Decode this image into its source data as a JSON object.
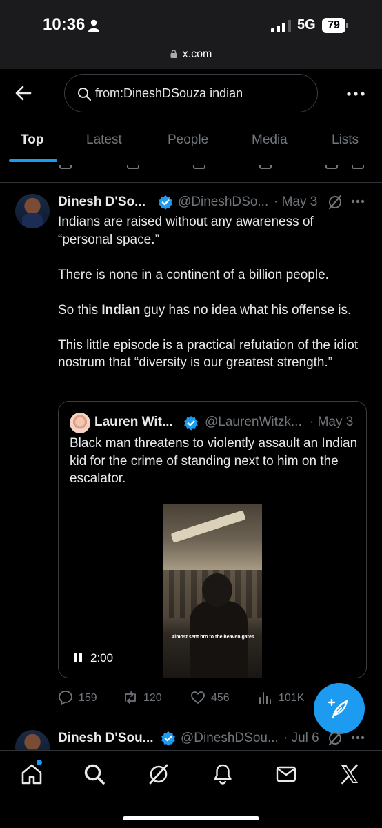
{
  "status_bar": {
    "time": "10:36",
    "network": "5G",
    "battery": "79",
    "url": "x.com"
  },
  "header": {
    "search_value": "from:DineshDSouza indian"
  },
  "tabs": [
    {
      "label": "Top",
      "active": true
    },
    {
      "label": "Latest",
      "active": false
    },
    {
      "label": "People",
      "active": false
    },
    {
      "label": "Media",
      "active": false
    },
    {
      "label": "Lists",
      "active": false
    }
  ],
  "tweet": {
    "author_name": "Dinesh D'So...",
    "author_handle": "@DineshDSo...",
    "date": "· May 3",
    "paragraphs": [
      "Indians are raised without any awareness of “personal space.”",
      "There is none in a continent of a billion people.",
      "This little episode is a practical refutation of the idiot nostrum that  “diversity is our greatest strength.”"
    ],
    "para3_before": "So this ",
    "para3_bold": "Indian",
    "para3_after": " guy has no idea what his offense is.",
    "quote": {
      "author_name": "Lauren Wit...",
      "author_handle": "@LaurenWitzk...",
      "date": "· May 3",
      "text": "Black man threatens to violently assault an Indian kid for the crime of standing next to him on the escalator.",
      "video_caption": "Almost sent bro to the heaven gates",
      "video_time": "2:00"
    },
    "stats": {
      "replies": "159",
      "reposts": "120",
      "likes": "456",
      "views": "101K"
    }
  },
  "next_tweet": {
    "author_name": "Dinesh D'Sou...",
    "author_handle": "@DineshDSou...",
    "date": "· Jul 6"
  },
  "colors": {
    "accent": "#1d9bf0",
    "background": "#000000",
    "secondary_text": "#71767b",
    "divider": "#2f3336"
  },
  "nav_icons": [
    "home-icon",
    "search-icon",
    "grok-icon",
    "notifications-icon",
    "messages-icon",
    "x-logo-icon"
  ]
}
